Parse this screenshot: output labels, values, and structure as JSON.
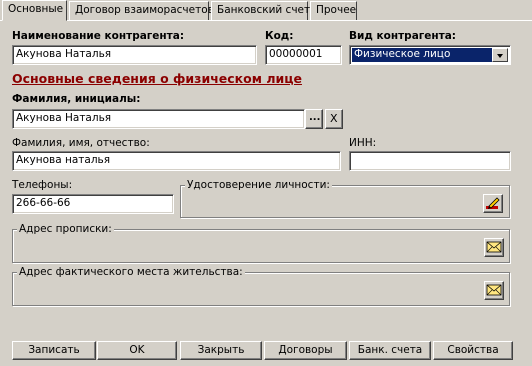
{
  "tabs": [
    {
      "label": "Основные"
    },
    {
      "label": "Договор взаиморасчетов"
    },
    {
      "label": "Банковский счет"
    },
    {
      "label": "Прочее"
    }
  ],
  "header": {
    "name_label": "Наименование контрагента:",
    "name_value": "Акунова Наталья",
    "code_label": "Код:",
    "code_value": "00000001",
    "type_label": "Вид контрагента:",
    "type_value": "Физическое лицо"
  },
  "section_title": "Основные сведения о физическом лице",
  "person": {
    "initials_label": "Фамилия, инициалы:",
    "initials_value": "Акунова Наталья",
    "browse_label": "...",
    "clear_label": "X",
    "fullname_label": "Фамилия, имя, отчество:",
    "fullname_value": "Акунова наталья",
    "inn_label": "ИНН:",
    "inn_value": "",
    "phones_label": "Телефоны:",
    "phones_value": "266-66-66",
    "id_doc_label": "Удостоверение личности:",
    "reg_address_label": "Адрес прописки:",
    "actual_address_label": "Адрес фактического места жительства:"
  },
  "buttons": {
    "save": "Записать",
    "ok": "OK",
    "close": "Закрыть",
    "contracts": "Договоры",
    "bank_accounts": "Банк. счета",
    "properties": "Свойства"
  },
  "icons": {
    "edit": "pencil-edit-icon",
    "envelope": "envelope-icon"
  }
}
